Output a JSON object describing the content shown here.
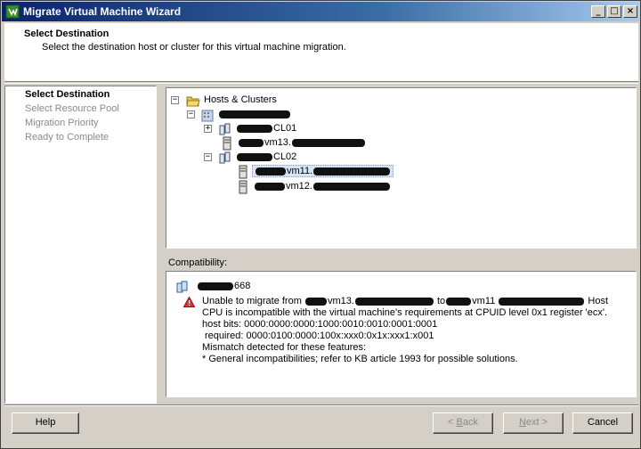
{
  "window": {
    "title": "Migrate Virtual Machine Wizard",
    "minimize": "_",
    "maximize": "□",
    "close": "×"
  },
  "header": {
    "title": "Select Destination",
    "subtitle": "Select the destination host or cluster for this virtual machine migration."
  },
  "steps": [
    {
      "label": "Select Destination",
      "state": "active"
    },
    {
      "label": "Select Resource Pool",
      "state": "inactive"
    },
    {
      "label": "Migration Priority",
      "state": "inactive"
    },
    {
      "label": "Ready to Complete",
      "state": "inactive"
    }
  ],
  "tree": {
    "root": {
      "label": "Hosts & Clusters",
      "icon": "folder-icon",
      "expander": "−"
    },
    "datacenter": {
      "expander": "−",
      "icon": "datacenter-icon"
    },
    "cluster1": {
      "suffix": "CL01",
      "expander": "+",
      "icon": "cluster-icon"
    },
    "host13": {
      "middle": "vm13.",
      "icon": "host-icon"
    },
    "cluster2": {
      "suffix": "CL02",
      "expander": "−",
      "icon": "cluster-icon"
    },
    "host11": {
      "middle": "vm11.",
      "icon": "host-icon",
      "selected": true
    },
    "host12": {
      "middle": "vm12.",
      "icon": "host-icon"
    }
  },
  "compatibility": {
    "label": "Compatibility:",
    "item": {
      "suffix": "668",
      "icon": "cluster-icon"
    },
    "error_icon": "warning-icon",
    "lines": {
      "l1_a": "Unable to migrate from",
      "l1_b": "vm13.",
      "l1_c": "to",
      "l1_d": "vm11",
      "l1_e": "Host",
      "l2": "CPU is incompatible with the virtual machine's requirements at CPUID level 0x1 register 'ecx'.",
      "l3": "host bits: 0000:0000:0000:1000:0010:0010:0001:0001",
      "l4": "required: 0000:0100:0000:100x:xxx0:0x1x:xxx1:x001",
      "l5": "Mismatch detected for these features:",
      "l6": "* General incompatibilities; refer to KB article 1993 for possible solutions."
    }
  },
  "buttons": {
    "help": "Help",
    "back_prefix": "< ",
    "back_mnemonic": "B",
    "back_rest": "ack",
    "next_prefix": "",
    "next_mnemonic": "N",
    "next_rest": "ext >",
    "cancel": "Cancel"
  },
  "colors": {
    "title_bar": "#0a246a",
    "selection": "#d6e5f5",
    "warning": "#e03030"
  }
}
